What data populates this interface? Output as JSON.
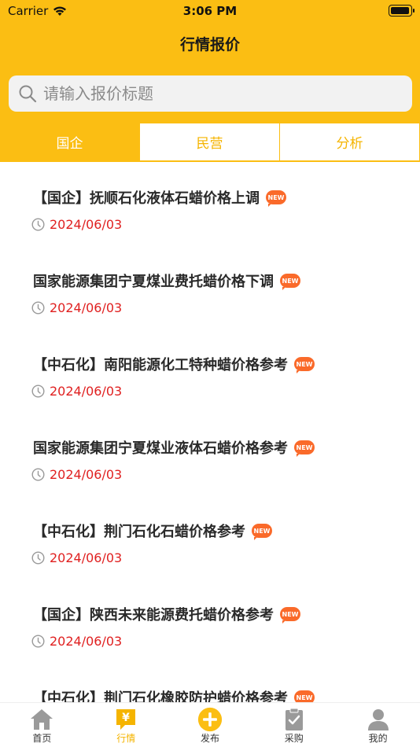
{
  "status_bar": {
    "carrier": "Carrier",
    "time": "3:06 PM"
  },
  "header": {
    "title": "行情报价"
  },
  "search": {
    "placeholder": "请输入报价标题"
  },
  "tabs": [
    {
      "label": "国企",
      "active": true
    },
    {
      "label": "民营",
      "active": false
    },
    {
      "label": "分析",
      "active": false
    }
  ],
  "badge_text": "NEW",
  "items": [
    {
      "title": "【国企】抚顺石化液体石蜡价格上调",
      "date": "2024/06/03"
    },
    {
      "title": "国家能源集团宁夏煤业费托蜡价格下调",
      "date": "2024/06/03"
    },
    {
      "title": "【中石化】南阳能源化工特种蜡价格参考",
      "date": "2024/06/03"
    },
    {
      "title": "国家能源集团宁夏煤业液体石蜡价格参考",
      "date": "2024/06/03"
    },
    {
      "title": "【中石化】荆门石化石蜡价格参考",
      "date": "2024/06/03"
    },
    {
      "title": "【国企】陕西未来能源费托蜡价格参考",
      "date": "2024/06/03"
    },
    {
      "title": "【中石化】荆门石化橡胶防护蜡价格参考",
      "date": ""
    }
  ],
  "tabbar": [
    {
      "label": "首页",
      "icon": "home-icon",
      "active": false
    },
    {
      "label": "行情",
      "icon": "yen-chat-icon",
      "active": true
    },
    {
      "label": "发布",
      "icon": "plus-circle-icon",
      "active": false
    },
    {
      "label": "采购",
      "icon": "clipboard-check-icon",
      "active": false
    },
    {
      "label": "我的",
      "icon": "user-icon",
      "active": false
    }
  ],
  "colors": {
    "accent": "#fbbe13",
    "date_red": "#e02020",
    "badge_orange": "#fa6a2a"
  }
}
